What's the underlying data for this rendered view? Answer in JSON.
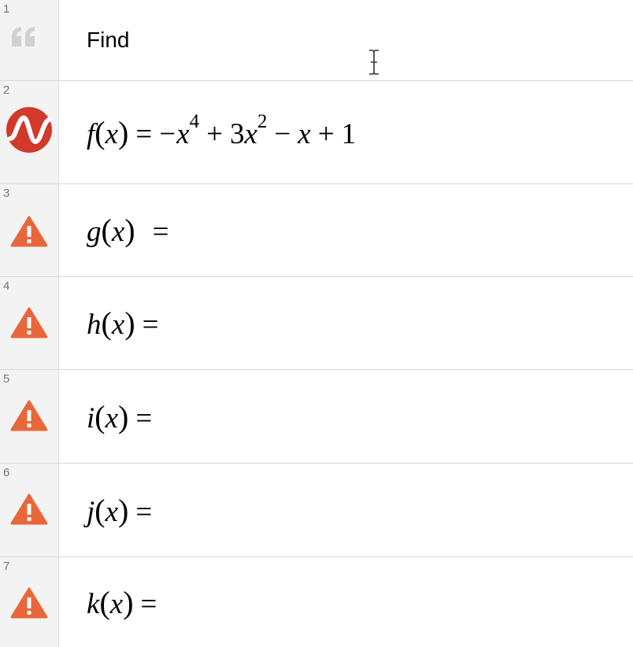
{
  "expressions": [
    {
      "number": "1",
      "type": "note",
      "icon": "quote-icon",
      "text": "Find"
    },
    {
      "number": "2",
      "type": "function",
      "icon": "graph-wave-icon",
      "name": "f",
      "var": "x",
      "equals": "=",
      "rhs": "−x⁴ + 3x² − x + 1"
    },
    {
      "number": "3",
      "type": "function",
      "icon": "warning-icon",
      "name": "g",
      "var": "x",
      "equals": "="
    },
    {
      "number": "4",
      "type": "function",
      "icon": "warning-icon",
      "name": "h",
      "var": "x",
      "equals": "="
    },
    {
      "number": "5",
      "type": "function",
      "icon": "warning-icon",
      "name": "i",
      "var": "x",
      "equals": "="
    },
    {
      "number": "6",
      "type": "function",
      "icon": "warning-icon",
      "name": "j",
      "var": "x",
      "equals": "="
    },
    {
      "number": "7",
      "type": "function",
      "icon": "warning-icon",
      "name": "k",
      "var": "x",
      "equals": "="
    }
  ],
  "f_terms": {
    "minus1": "−",
    "x1": "x",
    "exp1": "4",
    "plus1": "+",
    "coef2": "3",
    "x2": "x",
    "exp2": "2",
    "minus2": "−",
    "x3": "x",
    "plus2": "+",
    "const": "1"
  },
  "colors": {
    "warning": "#e8673a",
    "graph_icon": "#d1392b",
    "gutter": "#f3f3f3",
    "quote": "#d0d0d0"
  }
}
